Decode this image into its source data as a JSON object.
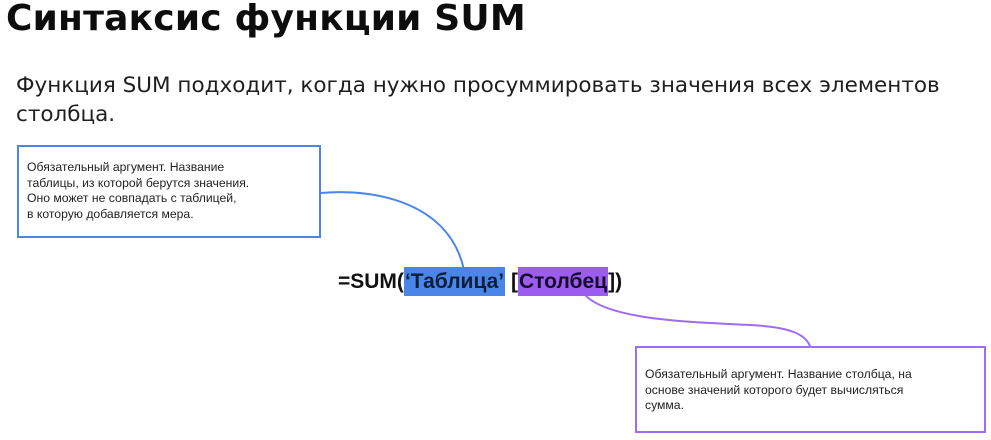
{
  "title": "Синтаксис функции SUM",
  "intro": "Функция SUM подходит, когда нужно просуммировать значения всех элементов столбца.",
  "formula": {
    "prefix": "=SUM(",
    "table_arg": "‘Таблица’",
    "space": " ",
    "bracket_open": "[",
    "column_arg": "Столбец",
    "bracket_close": "]",
    "suffix": ")"
  },
  "callouts": {
    "table": {
      "lines": [
        "Обязательный аргумент. Название",
        "таблицы, из которой берутся значения.",
        "Оно может не совпадать с таблицей,",
        "в которую добавляется мера."
      ]
    },
    "column": {
      "lines": [
        "Обязательный аргумент. Название столбца, на",
        "основе значений которого будет вычисляться",
        "сумма."
      ]
    }
  },
  "colors": {
    "table_accent": "#4a86e8",
    "column_accent": "#9d5cf0"
  }
}
